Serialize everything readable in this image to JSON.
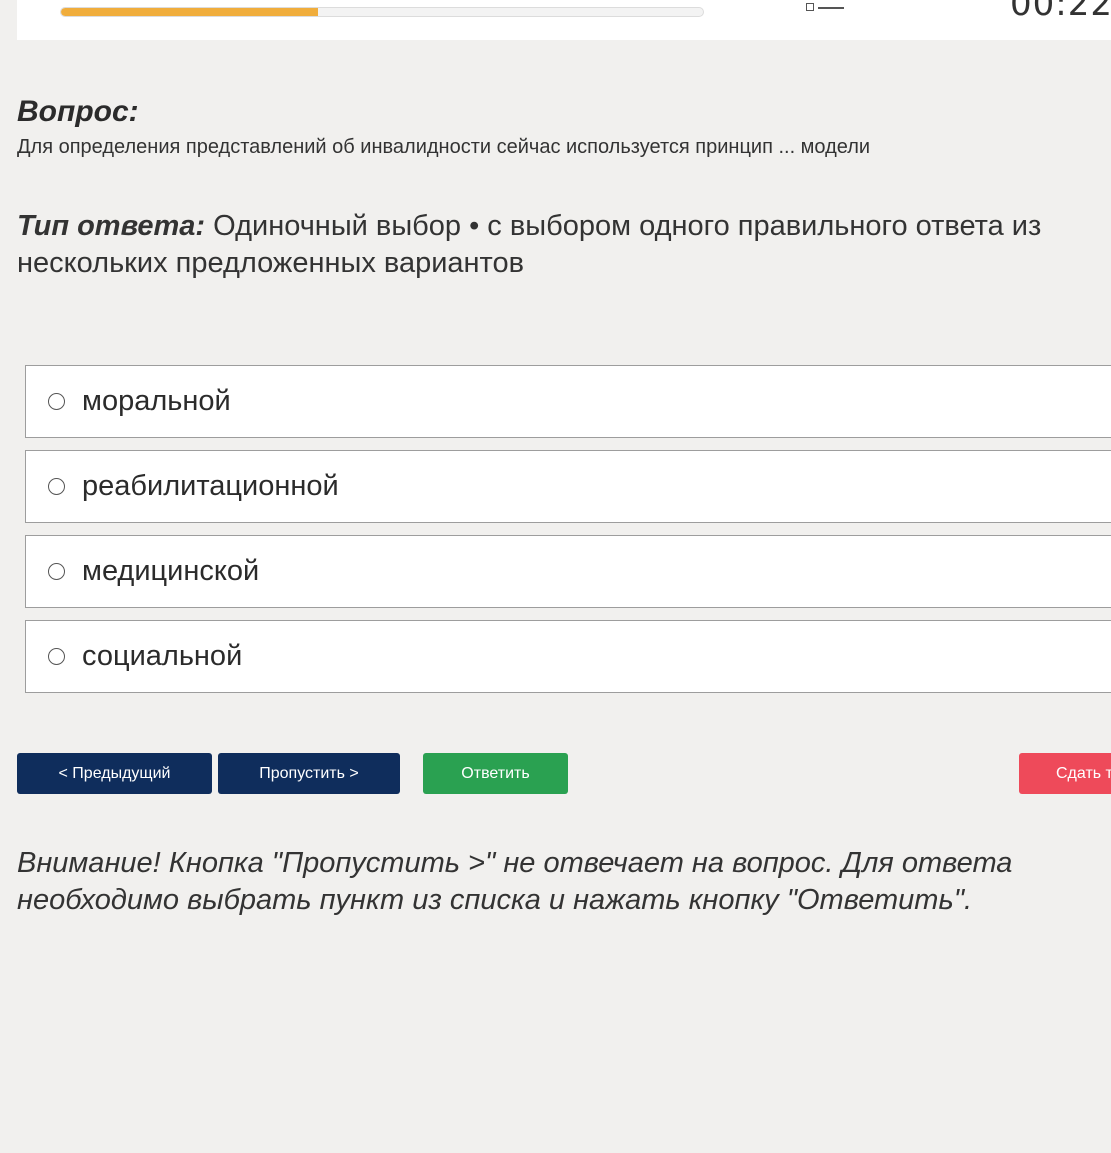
{
  "header": {
    "progress_percent": 40,
    "progress_color": "#f0ad3c",
    "nav_icon": "list-icon",
    "timer": "00:22"
  },
  "question": {
    "label": "Вопрос:",
    "text": "Для определения представлений об инвалидности сейчас используется принцип ... модели"
  },
  "answer_type": {
    "label": "Тип ответа:",
    "value": " Одиночный выбор • с выбором одного правильного ответа из нескольких предложенных вариантов"
  },
  "options": [
    {
      "label": "моральной"
    },
    {
      "label": "реабилитационной"
    },
    {
      "label": "медицинской"
    },
    {
      "label": "социальной"
    }
  ],
  "buttons": {
    "prev": "< Предыдущий",
    "skip": "Пропустить >",
    "answer": "Ответить",
    "submit": "Сдать т"
  },
  "colors": {
    "nav_button": "#0f2d5c",
    "answer_button": "#2aa151",
    "submit_button": "#ee4a5a"
  },
  "notice": "Внимание! Кнопка \"Пропустить >\" не отвечает на вопрос. Для ответа необходимо выбрать пункт из списка и нажать кнопку \"Ответить\"."
}
